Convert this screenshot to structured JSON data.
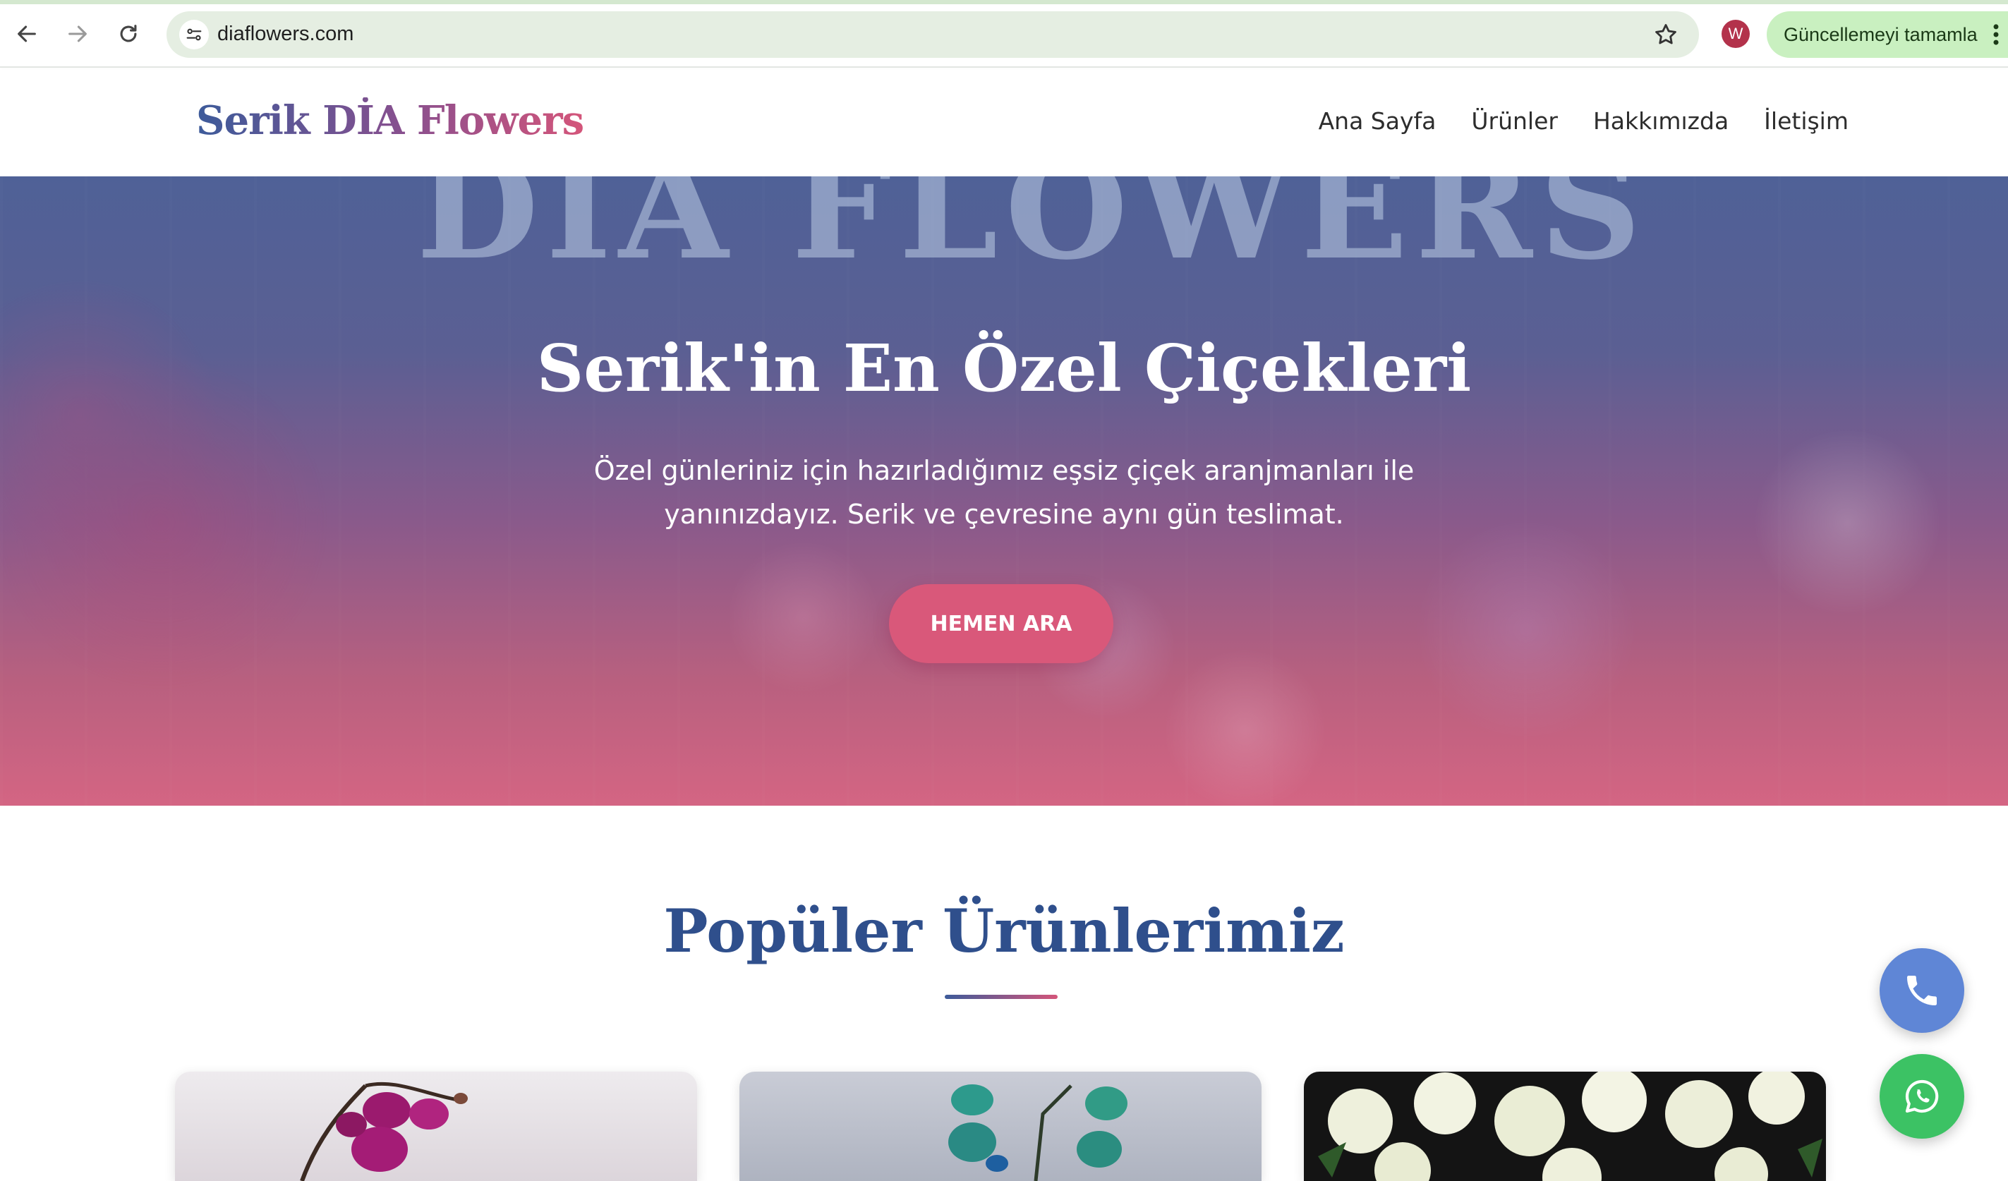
{
  "browser": {
    "url": "diaflowers.com",
    "profile_initial": "W",
    "update_label": "Güncellemeyi tamamla",
    "icons": [
      "back-arrow-icon",
      "forward-arrow-icon",
      "reload-icon",
      "site-info-icon",
      "bookmark-star-icon",
      "more-options-icon"
    ],
    "accent_color": "#c9f0c0"
  },
  "site": {
    "logo": "Serik DİA Flowers",
    "nav": {
      "home": "Ana Sayfa",
      "products": "Ürünler",
      "about": "Hakkımızda",
      "contact": "İletişim"
    }
  },
  "hero": {
    "sign": "DİA FLOWERS",
    "title": "Serik'in En Özel Çiçekleri",
    "subtitle": "Özel günleriniz için hazırladığımız eşsiz çiçek aranjmanları ile yanınızdayız. Serik ve çevresine aynı gün teslimat.",
    "cta": "HEMEN ARA",
    "cta_color": "#d9587a"
  },
  "products_section": {
    "title": "Popüler Ürünlerimiz",
    "title_color": "#2f4f8c",
    "cards": [
      "pink-orchid",
      "blue-orchid",
      "white-roses"
    ]
  },
  "floating_buttons": {
    "phone_color": "#5f86d6",
    "whatsapp_color": "#3cc264",
    "icons": [
      "phone-icon",
      "whatsapp-icon"
    ]
  }
}
